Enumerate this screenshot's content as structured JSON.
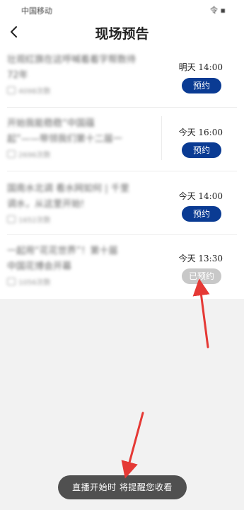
{
  "status_bar": {
    "carrier": "中国移动",
    "right": "令 ▪"
  },
  "header": {
    "title": "现场预告",
    "back_icon": "chevron-left-icon"
  },
  "items": [
    {
      "lines": [
        "壮观红旗在这呼喊着着字帮数待",
        "72年"
      ],
      "meta": "4098次数",
      "time": "明天 14:00",
      "button": "预约",
      "reserved": false
    },
    {
      "lines": [
        "开始我能稳稳“中国蕴",
        "起”——带领我们第十二届一"
      ],
      "meta": "2696次数",
      "time": "今天 16:00",
      "button": "预约",
      "reserved": false
    },
    {
      "lines": [
        "国南水北调 看水网如何 | 千里",
        "调水，从这里开始!"
      ],
      "meta": "1652次数",
      "time": "今天 14:00",
      "button": "预约",
      "reserved": false
    },
    {
      "lines": [
        "一起用“花花世界”！第十届",
        "中国花博会开幕"
      ],
      "meta": "1056次数",
      "time": "今天 13:30",
      "button": "已预约",
      "reserved": true
    }
  ],
  "toast": {
    "text": "直播开始时 将提醒您收看"
  },
  "colors": {
    "accent": "#0a3b93",
    "reserved": "#c8c8c8",
    "annotation_arrow": "#e53935"
  }
}
